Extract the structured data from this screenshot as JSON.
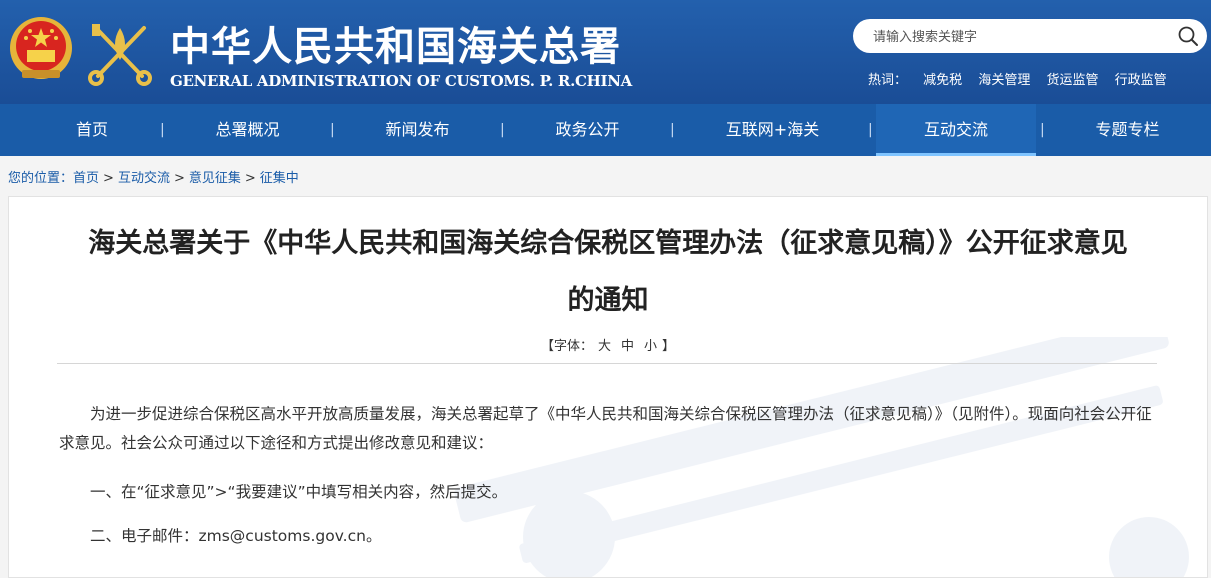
{
  "header": {
    "title_cn": "中华人民共和国海关总署",
    "title_en": "GENERAL ADMINISTRATION OF CUSTOMS. P. R.CHINA",
    "colors": {
      "header_bg": "#1b4f9a",
      "nav_bg": "#1a5ca8",
      "active_underline": "#7fc4ff"
    }
  },
  "search": {
    "placeholder": "请输入搜索关键字"
  },
  "hot_keywords": {
    "label": "热词：",
    "items": [
      "减免税",
      "海关管理",
      "货运监管",
      "行政监管"
    ]
  },
  "nav": {
    "items": [
      {
        "label": "首页"
      },
      {
        "label": "总署概况"
      },
      {
        "label": "新闻发布"
      },
      {
        "label": "政务公开"
      },
      {
        "label": "互联网+海关"
      },
      {
        "label": "互动交流",
        "active": true
      },
      {
        "label": "专题专栏"
      }
    ],
    "separator": "|"
  },
  "breadcrumb": {
    "prefix": "您的位置：",
    "items": [
      "首页",
      "互动交流",
      "意见征集",
      "征集中"
    ],
    "separator": ">"
  },
  "article": {
    "title_line1": "海关总署关于《中华人民共和国海关综合保税区管理办法（征求意见稿）》公开征求意见",
    "title_line2": "的通知",
    "font_size": {
      "open": "【字体：",
      "large": "大",
      "medium": "中",
      "small": "小",
      "close": "】"
    },
    "paragraphs": [
      "为进一步促进综合保税区高水平开放高质量发展，海关总署起草了《中华人民共和国海关综合保税区管理办法（征求意见稿）》（见附件）。现面向社会公开征求意见。社会公众可通过以下途径和方式提出修改意见和建议：",
      "一、在“征求意见”>“我要建议”中填写相关内容，然后提交。",
      "二、电子邮件：zms@customs.gov.cn。"
    ]
  }
}
